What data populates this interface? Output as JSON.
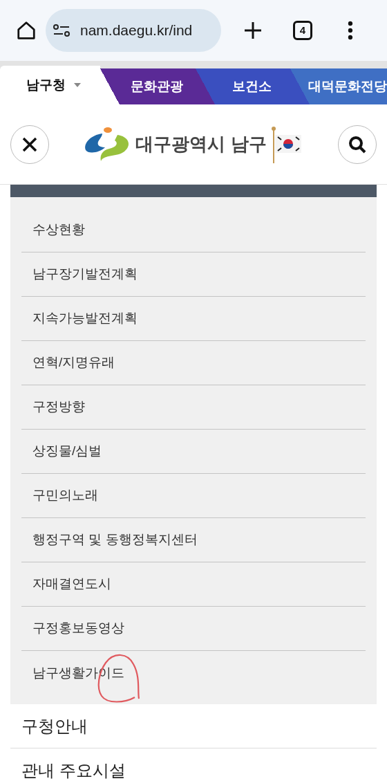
{
  "browser": {
    "url": "nam.daegu.kr/ind",
    "tab_count": "4"
  },
  "site_tabs": [
    {
      "label": "남구청",
      "selected": true,
      "color": "#ffffff"
    },
    {
      "label": "문화관광",
      "selected": false,
      "color": "#5a2a96"
    },
    {
      "label": "보건소",
      "selected": false,
      "color": "#3a4fbf"
    },
    {
      "label": "대덕문화전당",
      "selected": false,
      "color": "#3f6fc4"
    }
  ],
  "header": {
    "logo_text": "대구광역시 남구"
  },
  "submenu": {
    "items": [
      {
        "label": "수상현황",
        "annotated": false
      },
      {
        "label": "남구장기발전계획",
        "annotated": false
      },
      {
        "label": "지속가능발전계획",
        "annotated": false
      },
      {
        "label": "연혁/지명유래",
        "annotated": false
      },
      {
        "label": "구정방향",
        "annotated": false
      },
      {
        "label": "상징물/심벌",
        "annotated": false
      },
      {
        "label": "구민의노래",
        "annotated": false
      },
      {
        "label": "행정구역 및 동행정복지센터",
        "annotated": false
      },
      {
        "label": "자매결연도시",
        "annotated": false
      },
      {
        "label": "구정홍보동영상",
        "annotated": false
      },
      {
        "label": "남구생활가이드",
        "annotated": true
      }
    ]
  },
  "menu": {
    "items": [
      "구청안내",
      "관내 주요시설"
    ]
  }
}
